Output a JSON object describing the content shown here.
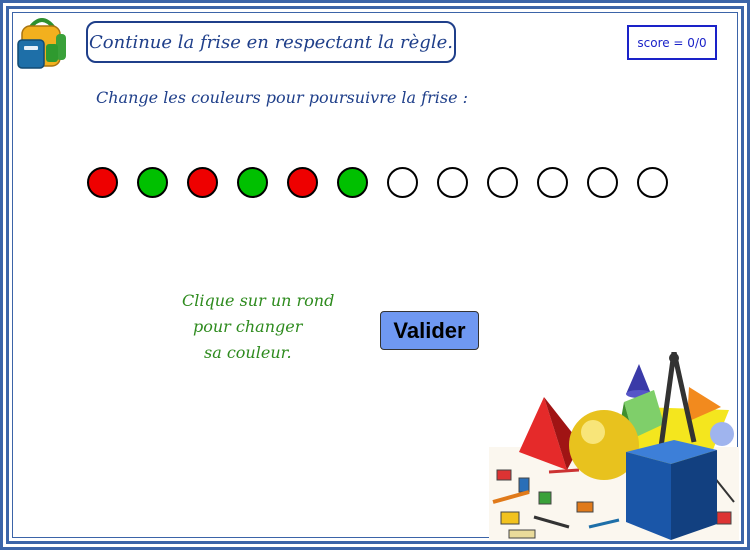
{
  "title": "Continue la frise en respectant la règle.",
  "score": {
    "label": "score = 0/0"
  },
  "instruction": "Change les couleurs pour poursuivre la frise :",
  "frieze": {
    "dots": [
      {
        "color": "#ee0000"
      },
      {
        "color": "#00c000"
      },
      {
        "color": "#ee0000"
      },
      {
        "color": "#00c000"
      },
      {
        "color": "#ee0000"
      },
      {
        "color": "#00c000"
      },
      {
        "color": "#ffffff"
      },
      {
        "color": "#ffffff"
      },
      {
        "color": "#ffffff"
      },
      {
        "color": "#ffffff"
      },
      {
        "color": "#ffffff"
      },
      {
        "color": "#ffffff"
      }
    ]
  },
  "hint": {
    "line1": "Clique sur un rond",
    "line2": "pour changer",
    "line3": "sa couleur."
  },
  "validate_button": "Valider",
  "icons": {
    "logo": "backpack-icon",
    "illustration": "geometry-shapes-illustration"
  },
  "colors": {
    "frame": "#3b64a8",
    "title_text": "#1f3f8a",
    "score_border": "#1a22c8",
    "hint_text": "#2e8b1e",
    "button_bg": "#6f98f2"
  }
}
